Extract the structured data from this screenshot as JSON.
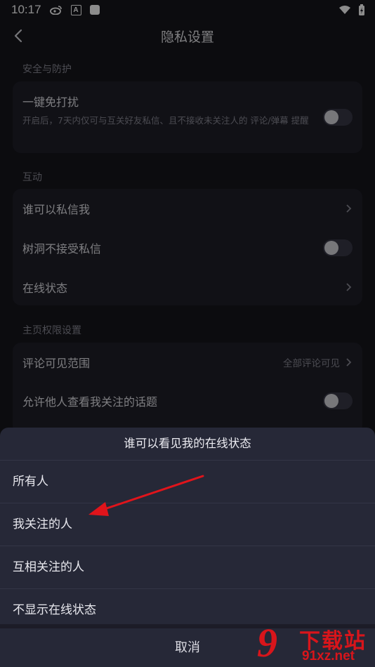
{
  "status_bar": {
    "time": "10:17",
    "a_badge": "A",
    "icons": [
      "weibo-icon",
      "a-notification-icon",
      "app-square-icon",
      "wifi-icon",
      "battery-charging-icon"
    ]
  },
  "header": {
    "title": "隐私设置"
  },
  "sections": {
    "security": {
      "label": "安全与防护",
      "dnd_title": "一键免打扰",
      "dnd_desc": "开启后，7天内仅可与互关好友私信、且不接收未关注人的 评论/弹幕 提醒",
      "dnd_on": false
    },
    "interaction": {
      "label": "互动",
      "who_can_message": "谁可以私信我",
      "treehole_title": "树洞不接受私信",
      "treehole_on": false,
      "online_status": "在线状态"
    },
    "homepage": {
      "label": "主页权限设置",
      "comment_scope": "评论可见范围",
      "comment_scope_value": "全部评论可见",
      "show_topics": "允许他人查看我关注的话题",
      "show_topics_on": false
    }
  },
  "sheet": {
    "title": "谁可以看见我的在线状态",
    "options": [
      "所有人",
      "我关注的人",
      "互相关注的人",
      "不显示在线状态"
    ],
    "cancel": "取消"
  },
  "annotation": {
    "arrow_color": "#e0141b"
  },
  "watermark": {
    "logo_glyph": "9",
    "cn_text": "下载站",
    "domain": "91xz.net",
    "color": "#d8151b"
  }
}
